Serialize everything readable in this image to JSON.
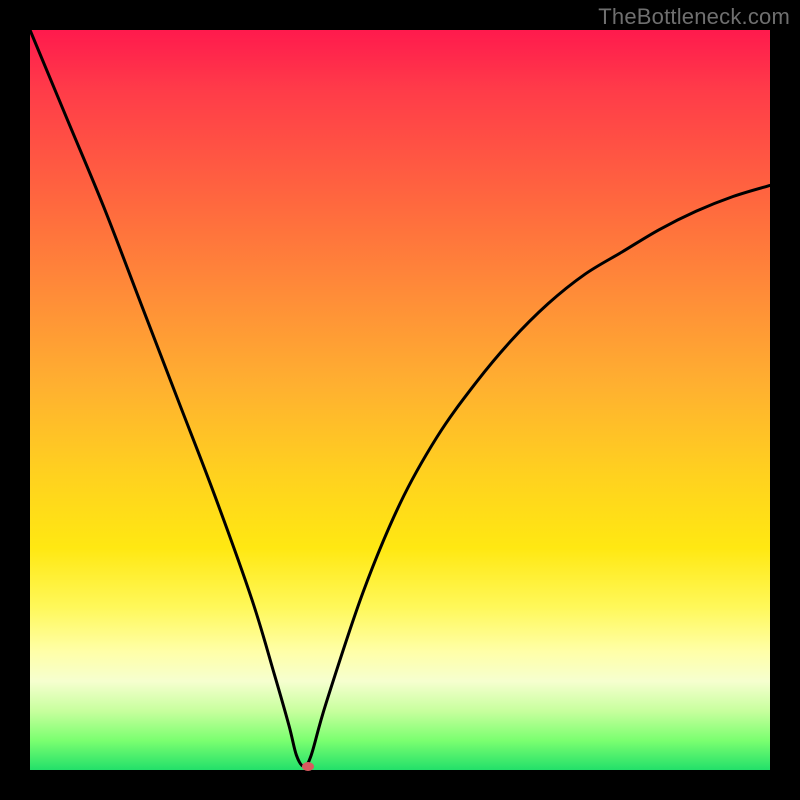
{
  "watermark": "TheBottleneck.com",
  "colors": {
    "frame": "#000000",
    "gradient_top": "#ff1a4d",
    "gradient_mid1": "#ff8d38",
    "gradient_mid2": "#ffe812",
    "gradient_bottom": "#22e06a",
    "curve": "#000000",
    "marker": "#d85a5f"
  },
  "chart_data": {
    "type": "line",
    "title": "",
    "xlabel": "",
    "ylabel": "",
    "xlim": [
      0,
      100
    ],
    "ylim": [
      0,
      100
    ],
    "note": "V-shaped bottleneck curve; minimum at x≈37, y≈0.5. y approximates bottleneck percentage 0–100.",
    "minimum": {
      "x": 37,
      "y": 0.5
    },
    "series": [
      {
        "name": "bottleneck-curve",
        "x": [
          0,
          5,
          10,
          15,
          20,
          25,
          30,
          33,
          35,
          36,
          37,
          38,
          40,
          45,
          50,
          55,
          60,
          65,
          70,
          75,
          80,
          85,
          90,
          95,
          100
        ],
        "values": [
          100,
          88,
          76,
          63,
          50,
          37,
          23,
          13,
          6,
          2,
          0.5,
          2,
          9,
          24,
          36,
          45,
          52,
          58,
          63,
          67,
          70,
          73,
          75.5,
          77.5,
          79
        ]
      }
    ],
    "markers": [
      {
        "name": "current-point",
        "x": 37.5,
        "y": 0.6
      }
    ]
  }
}
